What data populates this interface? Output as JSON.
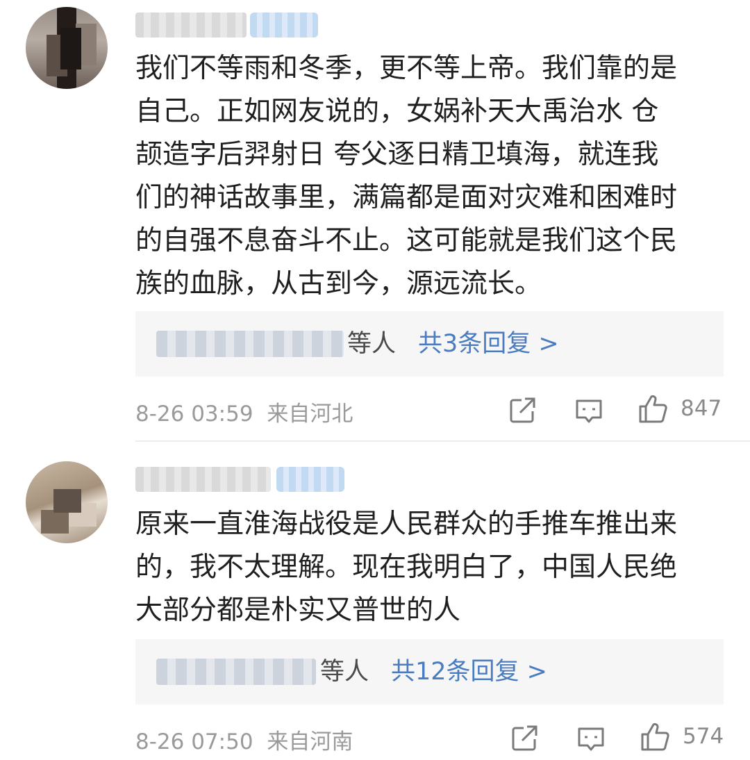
{
  "comments": [
    {
      "avatar_icon": "user-avatar",
      "text_lines": [
        "我们不等雨和冬季，更不等上帝。我们靠的是",
        "自己。正如网友说的，女娲补天大禹治水 仓",
        "颉造字后羿射日 夸父逐日精卫填海，就连我",
        "们的神话故事里，满篇都是面对灾难和困难时",
        "的自强不息奋斗不止。这可能就是我们这个民",
        "族的血脉，从古到今，源远流长。"
      ],
      "reply_suffix": "等人",
      "reply_link": "共3条回复 >",
      "time": "8-26 03:59",
      "location": "来自河北",
      "likes": "847"
    },
    {
      "avatar_icon": "user-avatar",
      "text_lines": [
        "原来一直淮海战役是人民群众的手推车推出来",
        "的，我不太理解。现在我明白了，中国人民绝",
        "大部分都是朴实又普世的人"
      ],
      "reply_suffix": "等人",
      "reply_link": "共12条回复 >",
      "time": "8-26 07:50",
      "location": "来自河南",
      "likes": "574"
    }
  ],
  "icons": {
    "share": "share-icon",
    "comment": "comment-icon",
    "like": "thumbs-up-icon"
  },
  "colors": {
    "text": "#1f1f1f",
    "link": "#4a7cc2",
    "meta": "#9a9a9a",
    "reply_bg": "#f6f6f6"
  }
}
